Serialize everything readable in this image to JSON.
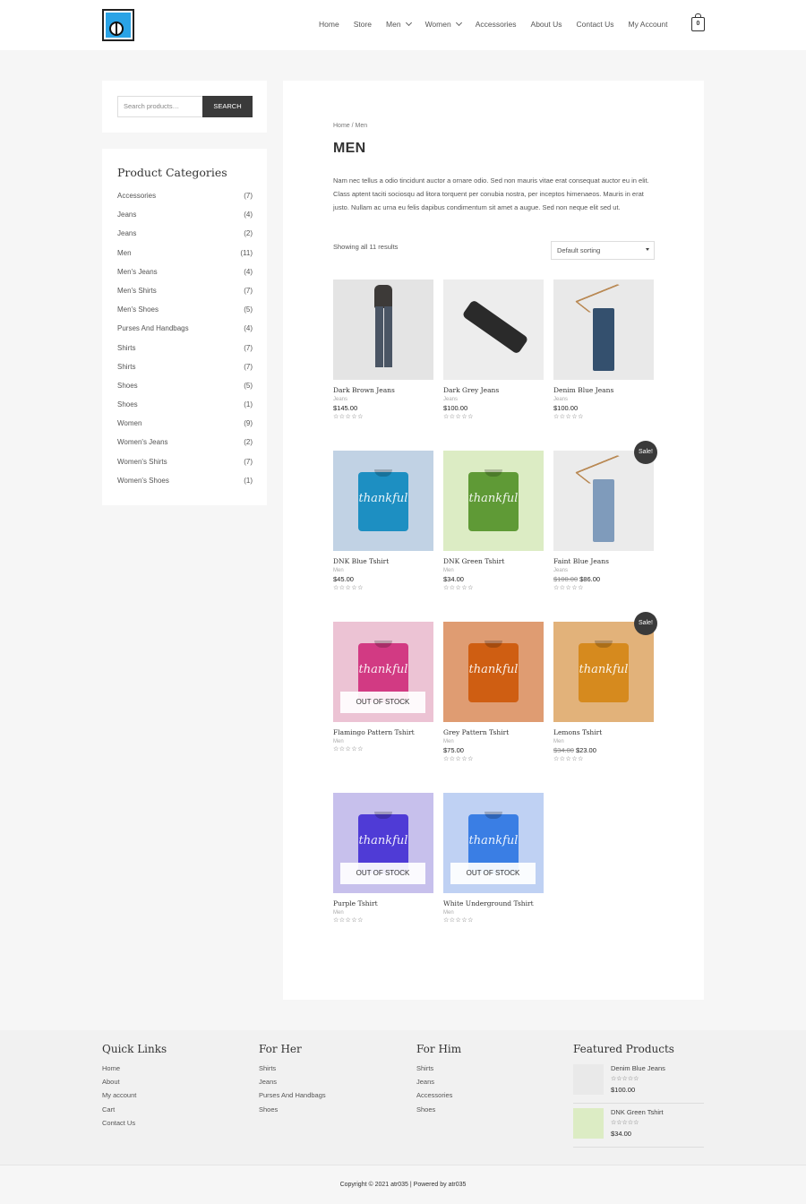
{
  "header": {
    "nav": [
      {
        "label": "Home",
        "dropdown": false
      },
      {
        "label": "Store",
        "dropdown": false
      },
      {
        "label": "Men",
        "dropdown": true
      },
      {
        "label": "Women",
        "dropdown": true
      },
      {
        "label": "Accessories",
        "dropdown": false
      },
      {
        "label": "About Us",
        "dropdown": false
      },
      {
        "label": "Contact Us",
        "dropdown": false
      },
      {
        "label": "My Account",
        "dropdown": false
      }
    ],
    "cart_count": "0"
  },
  "search": {
    "placeholder": "Search products…",
    "button": "SEARCH"
  },
  "categories": {
    "title": "Product Categories",
    "items": [
      {
        "name": "Accessories",
        "count": "(7)"
      },
      {
        "name": "Jeans",
        "count": "(4)"
      },
      {
        "name": "Jeans",
        "count": "(2)"
      },
      {
        "name": "Men",
        "count": "(11)"
      },
      {
        "name": "Men's Jeans",
        "count": "(4)"
      },
      {
        "name": "Men's Shirts",
        "count": "(7)"
      },
      {
        "name": "Men's Shoes",
        "count": "(5)"
      },
      {
        "name": "Purses And Handbags",
        "count": "(4)"
      },
      {
        "name": "Shirts",
        "count": "(7)"
      },
      {
        "name": "Shirts",
        "count": "(7)"
      },
      {
        "name": "Shoes",
        "count": "(5)"
      },
      {
        "name": "Shoes",
        "count": "(1)"
      },
      {
        "name": "Women",
        "count": "(9)"
      },
      {
        "name": "Women's Jeans",
        "count": "(2)"
      },
      {
        "name": "Women's Shirts",
        "count": "(7)"
      },
      {
        "name": "Women's Shoes",
        "count": "(1)"
      }
    ]
  },
  "main": {
    "breadcrumb": "Home / Men",
    "title": "MEN",
    "description": "Nam nec tellus a odio tincidunt auctor a ornare odio. Sed non mauris vitae erat consequat auctor eu in elit. Class aptent taciti sociosqu ad litora torquent per conubia nostra, per inceptos himenaeos. Mauris in erat justo. Nullam ac urna eu felis dapibus condimentum sit amet a augue. Sed non neque elit sed ut.",
    "result_count": "Showing all 11 results",
    "sorting": "Default sorting",
    "stars": "☆☆☆☆☆",
    "products": [
      {
        "name": "Dark Brown Jeans",
        "category": "Jeans",
        "price": "$145.00",
        "old_price": "",
        "badge": "",
        "art": "model",
        "color": "#e4e4e4"
      },
      {
        "name": "Dark Grey Jeans",
        "category": "Jeans",
        "price": "$100.00",
        "old_price": "",
        "badge": "",
        "art": "folded",
        "color": "#ededed"
      },
      {
        "name": "Denim Blue Jeans",
        "category": "Jeans",
        "price": "$100.00",
        "old_price": "",
        "badge": "",
        "art": "hanger",
        "color": "#e9e9e9"
      },
      {
        "name": "DNK Blue Tshirt",
        "category": "Men",
        "price": "$45.00",
        "old_price": "",
        "badge": "",
        "art": "tee",
        "color": "#c1d2e4",
        "tee_color": "#1d8fc2"
      },
      {
        "name": "DNK Green Tshirt",
        "category": "Men",
        "price": "$34.00",
        "old_price": "",
        "badge": "",
        "art": "tee",
        "color": "#dcecc4",
        "tee_color": "#5f9a36"
      },
      {
        "name": "Faint Blue Jeans",
        "category": "Jeans",
        "price": "$86.00",
        "old_price": "$100.00",
        "badge": "Sale!",
        "art": "hanger",
        "color": "#ebebeb"
      },
      {
        "name": "Flamingo Pattern Tshirt",
        "category": "Men",
        "price": "",
        "old_price": "",
        "badge": "OUT OF STOCK",
        "art": "tee",
        "color": "#ecc3d4",
        "tee_color": "#d23a83"
      },
      {
        "name": "Grey Pattern Tshirt",
        "category": "Men",
        "price": "$75.00",
        "old_price": "",
        "badge": "",
        "art": "tee",
        "color": "#df9c72",
        "tee_color": "#cf5e12"
      },
      {
        "name": "Lemons Tshirt",
        "category": "Men",
        "price": "$23.00",
        "old_price": "$34.00",
        "badge": "Sale!",
        "art": "tee",
        "color": "#e2b27a",
        "tee_color": "#d68a1e"
      },
      {
        "name": "Purple Tshirt",
        "category": "Men",
        "price": "",
        "old_price": "",
        "badge": "OUT OF STOCK",
        "art": "tee",
        "color": "#c7c0ec",
        "tee_color": "#4f3bd6"
      },
      {
        "name": "White Underground Tshirt",
        "category": "Men",
        "price": "",
        "old_price": "",
        "badge": "OUT OF STOCK",
        "art": "tee",
        "color": "#bfd1f3",
        "tee_color": "#3a7ee4"
      }
    ]
  },
  "footer": {
    "quick_links": {
      "title": "Quick Links",
      "links": [
        "Home",
        "About",
        "My account",
        "Cart",
        "Contact Us"
      ]
    },
    "for_her": {
      "title": "For Her",
      "links": [
        "Shirts",
        "Jeans",
        "Purses And Handbags",
        "Shoes"
      ]
    },
    "for_him": {
      "title": "For Him",
      "links": [
        "Shirts",
        "Jeans",
        "Accessories",
        "Shoes"
      ]
    },
    "featured": {
      "title": "Featured Products",
      "items": [
        {
          "name": "Denim Blue Jeans",
          "price": "$100.00",
          "color": "#e9e9e9"
        },
        {
          "name": "DNK Green Tshirt",
          "price": "$34.00",
          "color": "#dcecc4"
        }
      ]
    },
    "copyright": "Copyright © 2021 atr035 | Powered by atr035"
  }
}
